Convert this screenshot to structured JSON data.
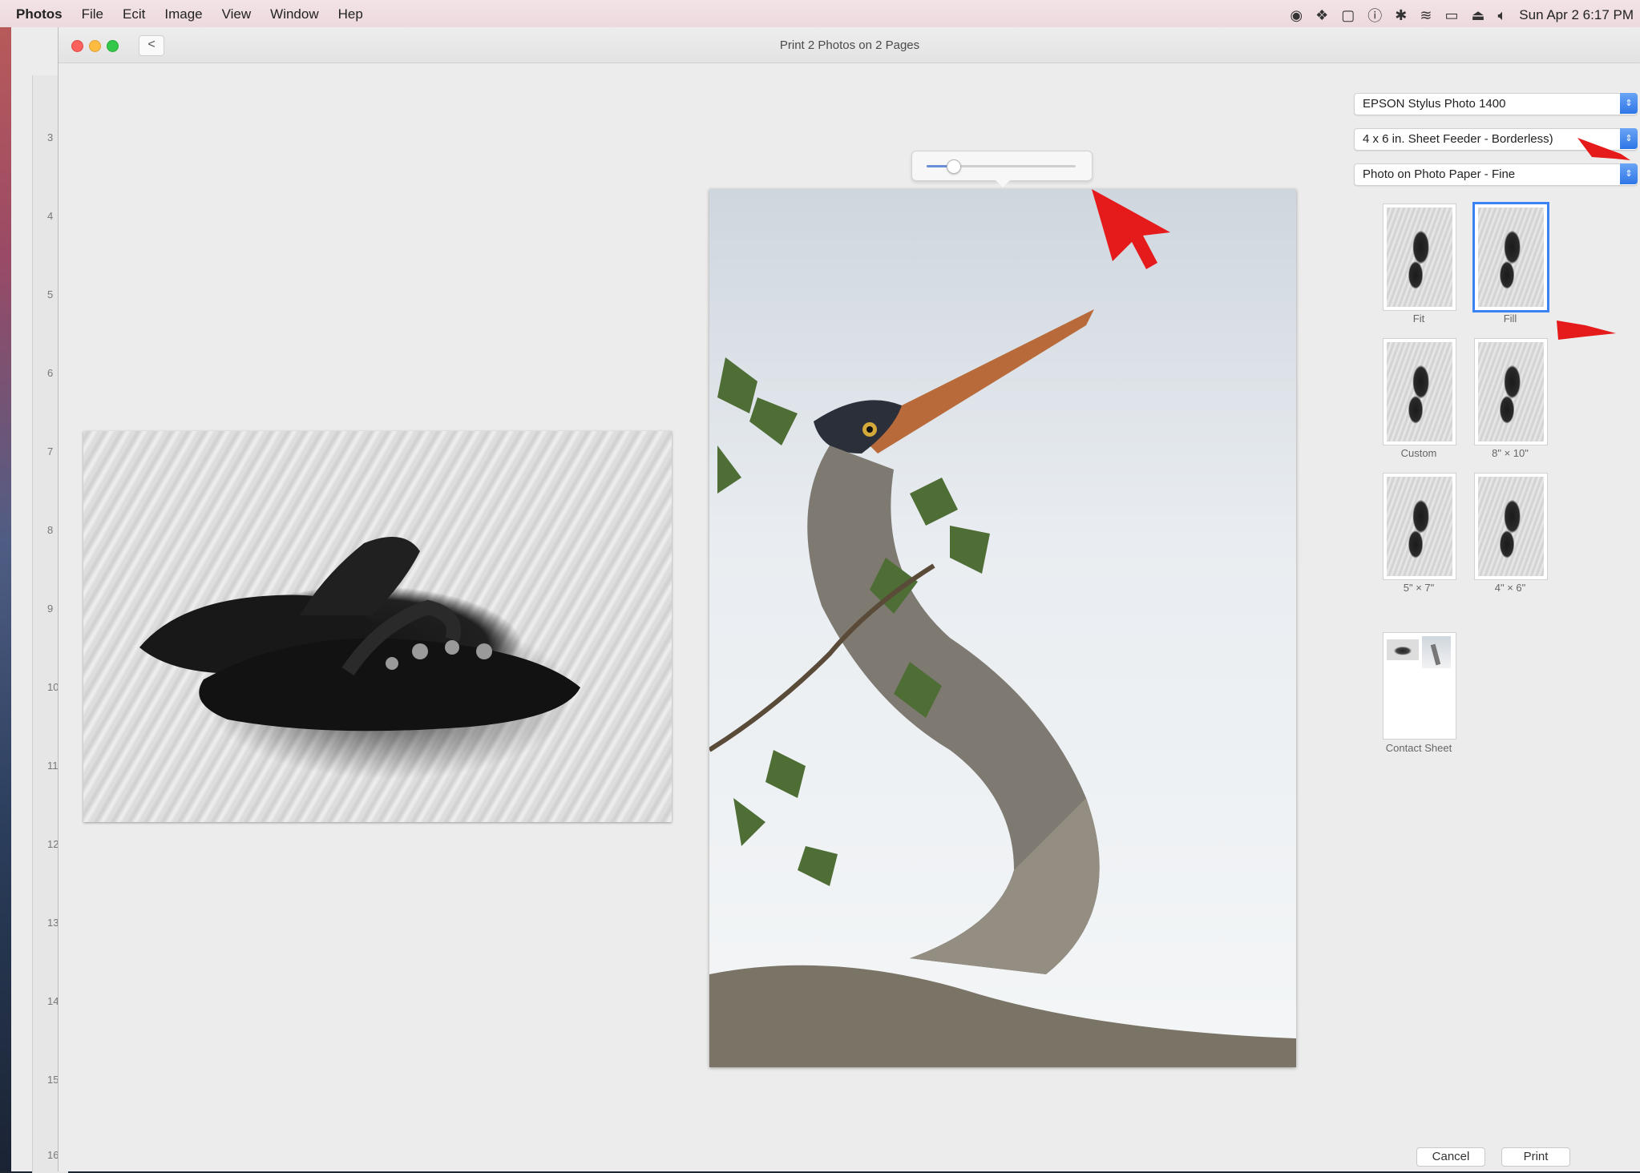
{
  "menubar": {
    "app": "Photos",
    "items": [
      "File",
      "Ecit",
      "Image",
      "View",
      "Window",
      "Hep"
    ],
    "status_icons": [
      "eye-icon",
      "dropbox-icon",
      "notification-icon",
      "info-icon",
      "bluetooth-icon",
      "wifi-icon",
      "airplay-icon",
      "eject-icon",
      "volume-icon"
    ],
    "clock": "Sun Apr 2 6:17 PM"
  },
  "window": {
    "title": "Print 2 Photos on 2 Pages",
    "back_label": "<"
  },
  "ruler_marks": [
    "3",
    "4",
    "5",
    "6",
    "7",
    "8",
    "9",
    "10",
    "11",
    "12",
    "13",
    "14",
    "15",
    "16"
  ],
  "zoom": {
    "level": 0.18
  },
  "photos": [
    {
      "subject": "black and white sandals on sand"
    },
    {
      "subject": "heron with leaves"
    }
  ],
  "panel": {
    "printer": "EPSON Stylus Photo 1400",
    "paper_size": "4 x 6 in. Sheet Feeder - Borderless)",
    "paper_type": "Photo on Photo Paper - Fine",
    "layouts": [
      {
        "label": "Fit",
        "selected": false
      },
      {
        "label": "Fill",
        "selected": true
      },
      {
        "label": "Custom",
        "selected": false
      },
      {
        "label": "8\" × 10\"",
        "selected": false
      },
      {
        "label": "5\" × 7\"",
        "selected": false
      },
      {
        "label": "4\" × 6\"",
        "selected": false
      },
      {
        "label": "Contact Sheet",
        "selected": false
      }
    ]
  },
  "buttons": {
    "cancel": "Cancel",
    "print": "Print"
  },
  "colors": {
    "accent": "#3b82f6",
    "annotation": "#e51a1a"
  }
}
